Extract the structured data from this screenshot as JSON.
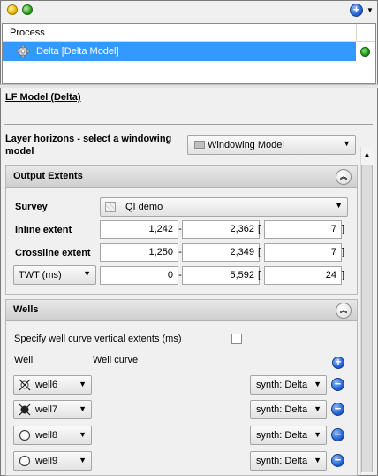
{
  "process_panel": {
    "header": "Process",
    "selected_item": "Delta [Delta Model]"
  },
  "model_title": "LF Model (Delta)",
  "layer_horizons": {
    "label": "Layer horizons - select a windowing model",
    "selected": "Windowing Model"
  },
  "output_extents": {
    "title": "Output Extents",
    "survey_label": "Survey",
    "survey_value": "QI demo",
    "inline": {
      "label": "Inline extent",
      "start": "1,242",
      "end": "2,362",
      "step": "7"
    },
    "crossline": {
      "label": "Crossline extent",
      "start": "1,250",
      "end": "2,349",
      "step": "7"
    },
    "time": {
      "domain_option": "TWT (ms)",
      "start": "0",
      "end": "5,592",
      "step": "24"
    },
    "dash": "-",
    "bracket_open": "[",
    "bracket_close": "]"
  },
  "wells": {
    "title": "Wells",
    "specify_label": "Specify well curve vertical extents (ms)",
    "specify_checked": false,
    "col_well": "Well",
    "col_curve": "Well curve",
    "rows": [
      {
        "well": "well6",
        "curve": "synth: Delta",
        "icon": "well-marker-icon"
      },
      {
        "well": "well7",
        "curve": "synth: Delta",
        "icon": "well-marker-icon"
      },
      {
        "well": "well8",
        "curve": "synth: Delta",
        "icon": "well-circle-icon"
      },
      {
        "well": "well9",
        "curve": "synth: Delta",
        "icon": "well-circle-icon"
      }
    ]
  },
  "colors": {
    "selection": "#3399ff",
    "accent_blue": "#1f5fd1",
    "status_green": "#1b9a10"
  }
}
